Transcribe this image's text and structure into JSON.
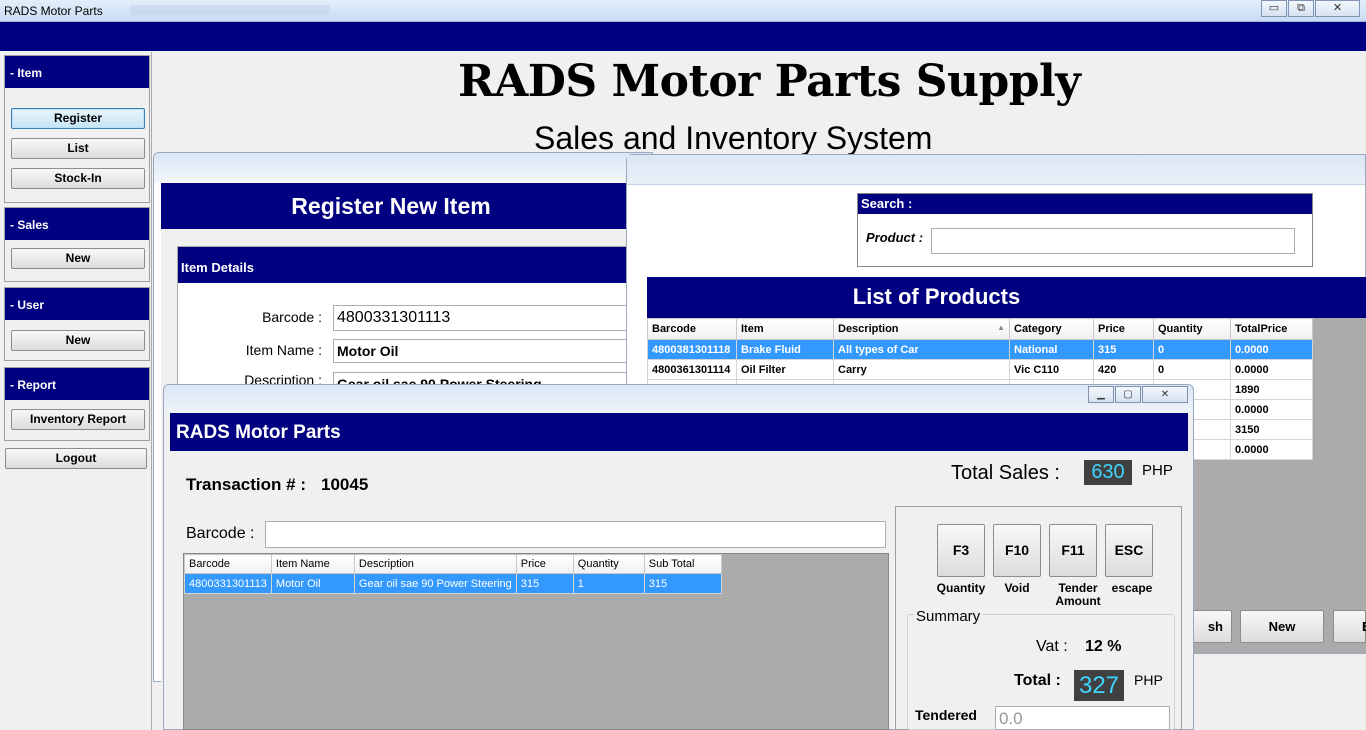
{
  "window": {
    "title": "RADS Motor Parts",
    "min": "▭",
    "max": "⧉",
    "close": "✕"
  },
  "sidebar": {
    "item": {
      "header": "- Item",
      "buttons": [
        "Register",
        "List",
        "Stock-In"
      ]
    },
    "sales": {
      "header": "- Sales",
      "buttons": [
        "New"
      ]
    },
    "user": {
      "header": "- User",
      "buttons": [
        "New"
      ]
    },
    "report": {
      "header": "- Report",
      "buttons": [
        "Inventory Report"
      ]
    },
    "logout": "Logout"
  },
  "main": {
    "title": "RADS Motor Parts Supply",
    "subtitle": "Sales and Inventory System"
  },
  "register": {
    "header": "Register New Item",
    "section": "Item Details",
    "barcode_label": "Barcode :",
    "barcode_value": "4800331301113",
    "itemname_label": "Item Name :",
    "itemname_value": "Motor Oil",
    "description_label": "Description :",
    "description_value": "Gear oil sae 90 Power Steering"
  },
  "product_list": {
    "search_header": "Search :",
    "product_label": "Product :",
    "product_placeholder": "",
    "header": "List of Products",
    "columns": [
      "Barcode",
      "Item",
      "Description",
      "Category",
      "Price",
      "Quantity",
      "TotalPrice"
    ],
    "rows": [
      [
        "4800381301118",
        "Brake Fluid",
        "All types of Car",
        "National",
        "315",
        "0",
        "0.0000"
      ],
      [
        "4800361301114",
        "Oil Filter",
        "Carry",
        "Vic C110",
        "420",
        "0",
        "0.0000"
      ]
    ],
    "partial_totals": [
      "1890",
      "0.0000",
      "3150",
      "0.0000"
    ],
    "buttons": {
      "refresh_partial": "sh",
      "new": "New",
      "third_partial": "E"
    }
  },
  "pos": {
    "title": "RADS Motor Parts",
    "transaction_label": "Transaction # :",
    "transaction_number": "10045",
    "total_sales_label": "Total Sales :",
    "total_sales_value": "630",
    "currency": "PHP",
    "barcode_label": "Barcode :",
    "barcode_value": "",
    "columns": [
      "Barcode",
      "Item Name",
      "Description",
      "Price",
      "Quantity",
      "Sub Total"
    ],
    "rows": [
      [
        "4800331301113",
        "Motor Oil",
        "Gear oil sae 90 Power Steering",
        "315",
        "1",
        "315"
      ]
    ],
    "fkeys": [
      {
        "key": "F3",
        "caption": "Quantity"
      },
      {
        "key": "F10",
        "caption": "Void"
      },
      {
        "key": "F11",
        "caption": "Tender Amount"
      },
      {
        "key": "ESC",
        "caption": "escape"
      }
    ],
    "summary_label": "Summary",
    "vat_label": "Vat :",
    "vat_value": "12 %",
    "total_label": "Total :",
    "total_value": "327",
    "tendered_label": "Tendered",
    "tendered_value": "0.0"
  }
}
